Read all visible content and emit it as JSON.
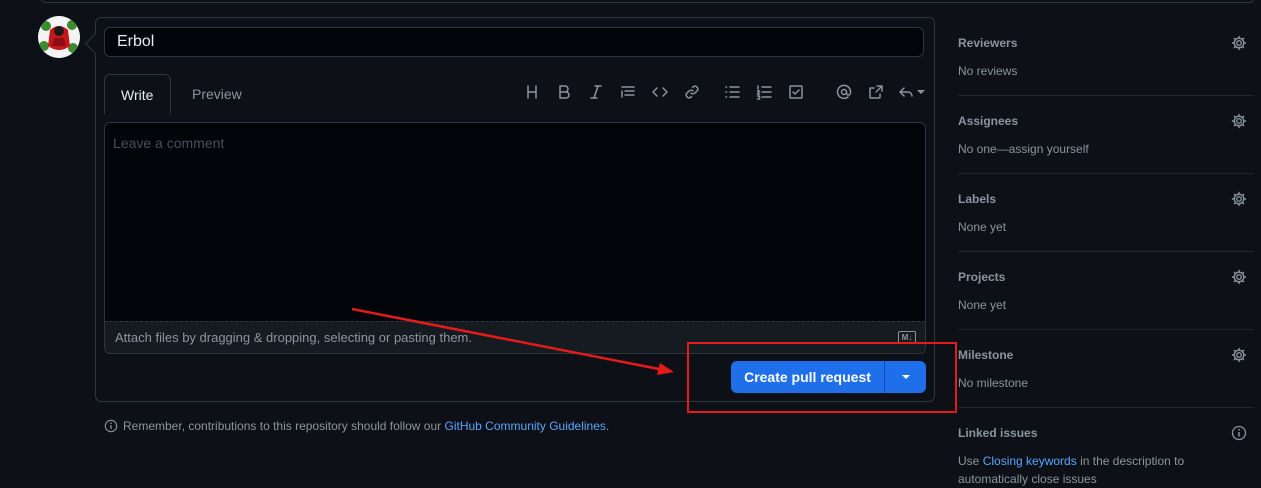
{
  "form": {
    "title_value": "Erbol",
    "tabs": {
      "write": "Write",
      "preview": "Preview"
    },
    "toolbar_icons": [
      "heading-icon",
      "bold-icon",
      "italic-icon",
      "quote-icon",
      "code-icon",
      "link-icon",
      "unordered-list-icon",
      "ordered-list-icon",
      "task-list-icon",
      "mention-icon",
      "cross-reference-icon",
      "saved-reply-icon"
    ],
    "comment_placeholder": "Leave a comment",
    "attach_text": "Attach files by dragging & dropping, selecting or pasting them.",
    "markdown_badge": "M↓",
    "create_button_label": "Create pull request"
  },
  "notice": {
    "prefix": "Remember, contributions to this repository should follow our",
    "link": "GitHub Community Guidelines",
    "suffix": "."
  },
  "sidebar": {
    "reviewers": {
      "title": "Reviewers",
      "value": "No reviews"
    },
    "assignees": {
      "title": "Assignees",
      "value": "No one—assign yourself"
    },
    "labels": {
      "title": "Labels",
      "value": "None yet"
    },
    "projects": {
      "title": "Projects",
      "value": "None yet"
    },
    "milestone": {
      "title": "Milestone",
      "value": "No milestone"
    },
    "linked_issues": {
      "title": "Linked issues",
      "prefix": "Use",
      "link": "Closing keywords",
      "suffix": "in the description to automatically close issues"
    }
  },
  "colors": {
    "background": "#0d1117",
    "primary_button": "#1f6feb",
    "link": "#58a6ff",
    "annotation": "#e31b1b"
  }
}
